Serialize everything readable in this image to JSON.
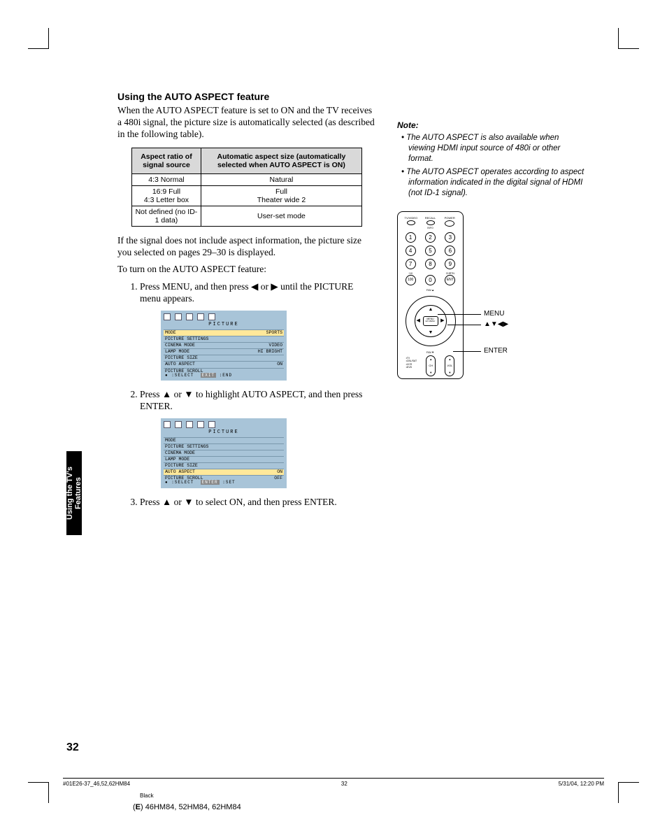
{
  "heading": "Using the AUTO ASPECT feature",
  "intro": "When the AUTO ASPECT feature is set to ON and the TV receives a 480i signal, the picture size is automatically selected (as described in the following table).",
  "table": {
    "header1": "Aspect ratio of signal source",
    "header2": "Automatic aspect size (automatically selected when AUTO ASPECT is ON)",
    "rows": [
      {
        "c1": "4:3 Normal",
        "c2": "Natural"
      },
      {
        "c1": "16:9 Full\n4:3 Letter box",
        "c2": "Full\nTheater wide 2"
      },
      {
        "c1": "Not defined (no ID-1 data)",
        "c2": "User-set mode"
      }
    ]
  },
  "para2": "If the signal does not include aspect information, the picture size you selected on pages 29–30 is displayed.",
  "para3": "To turn on the AUTO ASPECT feature:",
  "steps": {
    "s1a": "Press MENU, and then press ",
    "s1b": " or ",
    "s1c": " until the PICTURE menu appears.",
    "s2a": "Press ",
    "s2b": " or ",
    "s2c": " to highlight AUTO ASPECT, and then press ENTER.",
    "s3a": "Press ",
    "s3b": " or ",
    "s3c": " to select ON, and then press ENTER."
  },
  "osd": {
    "title": "PICTURE",
    "rows": [
      {
        "l": "MODE",
        "v": "SPORTS"
      },
      {
        "l": "PICTURE SETTINGS",
        "v": ""
      },
      {
        "l": "CINEMA MODE",
        "v": "VIDEO"
      },
      {
        "l": "LAMP MODE",
        "v": "HI BRIGHT"
      },
      {
        "l": "PICTURE SIZE",
        "v": ""
      },
      {
        "l": "AUTO ASPECT",
        "v": "ON"
      },
      {
        "l": "PICTURE SCROLL",
        "v": ""
      }
    ],
    "footer1": ":SELECT",
    "footer1b": "EXIT",
    "footer1c": ":END",
    "rows2": [
      {
        "l": "MODE",
        "v": ""
      },
      {
        "l": "PICTURE SETTINGS",
        "v": ""
      },
      {
        "l": "CINEMA MODE",
        "v": ""
      },
      {
        "l": "LAMP MODE",
        "v": ""
      },
      {
        "l": "PICTURE SIZE",
        "v": ""
      },
      {
        "l": "AUTO ASPECT",
        "v": "ON"
      },
      {
        "l": "PICTURE SCROLL",
        "v": "OFF"
      }
    ],
    "hi_value": "ON",
    "off_value": "OFF",
    "footer2b": "ENTER",
    "footer2c": ":SET"
  },
  "note": {
    "label": "Note:",
    "items": [
      "The AUTO ASPECT is also available when viewing HDMI input source of 480i or other format.",
      "The AUTO ASPECT operates according to aspect information indicated in the digital signal of HDMI (not ID-1 signal)."
    ]
  },
  "remote": {
    "top": [
      "TV/VIDEO",
      "RECALL",
      "POWER"
    ],
    "info": "INFO",
    "nums": [
      "1",
      "2",
      "3",
      "4",
      "5",
      "6",
      "7",
      "8",
      "9",
      "100",
      "0",
      "ENT"
    ],
    "plus10": "+10",
    "chrtn": "CHRTN",
    "favup": "FAV▲",
    "favdn": "FAV▼",
    "menu": "MENU",
    "exmenu": "EX MENU",
    "ch": "CH",
    "vol": "VOL",
    "modes": [
      "TV",
      "CBL/SAT",
      "VCR",
      "DVD"
    ],
    "callouts": {
      "menu": "MENU",
      "arrows": "▲▼◀▶",
      "enter": "ENTER"
    }
  },
  "sidetab": "Using the TV's Features",
  "pagenum": "32",
  "footer": {
    "left": "#01E26-37_46,52,62HM84",
    "mid": "32",
    "right": "5/31/04, 12:20 PM",
    "black": "Black",
    "model": "(E) 46HM84, 52HM84, 62HM84"
  },
  "arrows": {
    "left": "◀",
    "right": "▶",
    "up": "▲",
    "down": "▼"
  }
}
